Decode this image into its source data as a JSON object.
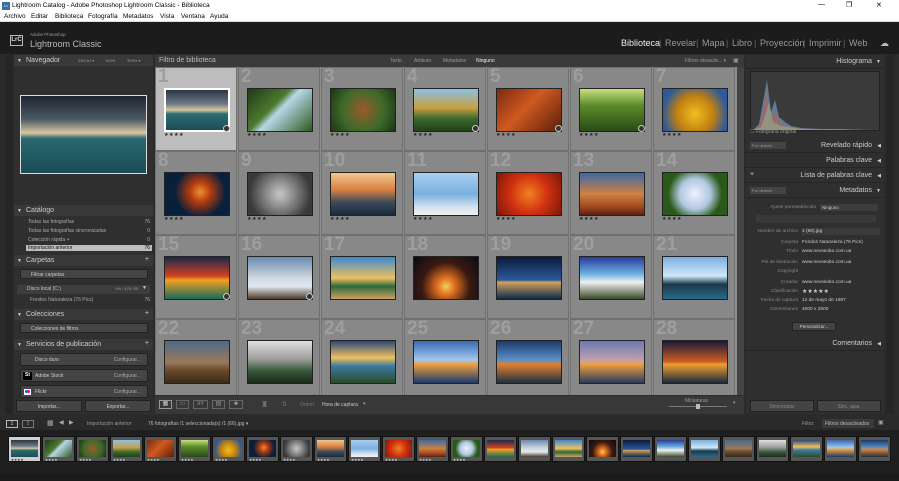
{
  "window": {
    "title": "Lightroom Catalog - Adobe Photoshop Lightroom Classic - Biblioteca",
    "icon": "Lr",
    "controls": [
      "—",
      "❐",
      "✕"
    ]
  },
  "menu": [
    "Archivo",
    "Editar",
    "Biblioteca",
    "Fotografía",
    "Metadatos",
    "Vista",
    "Ventana",
    "Ayuda"
  ],
  "brand": {
    "logo": "LrC",
    "line1": "Adobe Photoshop",
    "line2": "Lightroom Classic"
  },
  "modules": [
    "Biblioteca",
    "Revelar",
    "Mapa",
    "Libro",
    "Proyección",
    "Imprimir",
    "Web"
  ],
  "navigator": {
    "title": "Navegador",
    "zoom": [
      "ENCAJ ▾",
      "100%",
      "300% ▾"
    ]
  },
  "catalog": {
    "title": "Catálogo",
    "items": [
      {
        "label": "Todas las fotografías",
        "count": "76"
      },
      {
        "label": "Todas las fotografías sincronizadas",
        "count": "0"
      },
      {
        "label": "Colección rápida +",
        "count": "0"
      },
      {
        "label": "Importación anterior",
        "count": "76"
      }
    ]
  },
  "folders": {
    "title": "Carpetas",
    "filter": "Filtrar carpetas",
    "drive": "Disco local (C:)",
    "drive_space": "9% / 476 GB",
    "folder": "Fondos Naturaleza (76 Pics)",
    "folder_count": "76"
  },
  "collections": {
    "title": "Colecciones",
    "filter": "Colecciones de filtros"
  },
  "publish": {
    "title": "Servicios de publicación",
    "services": [
      {
        "name": "Disco duro",
        "action": "Configurar..."
      },
      {
        "name": "Adobe Stock",
        "action": "Configurar..."
      },
      {
        "name": "Flickr",
        "action": "Configurar..."
      }
    ]
  },
  "left_buttons": {
    "import": "Importar...",
    "export": "Exportar..."
  },
  "filterbar": {
    "title": "Filtro de biblioteca",
    "tabs": [
      "Texto",
      "Atributo",
      "Metadatos",
      "Ninguno"
    ],
    "preset": "Filtros desactiv... ▾"
  },
  "grid": {
    "cells": [
      {
        "num": "1",
        "stars": "★★★★",
        "selected": true
      },
      {
        "num": "2",
        "stars": "★★★★"
      },
      {
        "num": "3",
        "stars": "★★★★"
      },
      {
        "num": "4",
        "stars": "★★★★"
      },
      {
        "num": "5",
        "stars": "★★★★"
      },
      {
        "num": "6",
        "stars": "★★★★"
      },
      {
        "num": "7",
        "stars": "★★★★"
      },
      {
        "num": "8",
        "stars": "★★★★"
      },
      {
        "num": "9",
        "stars": "★★★★"
      },
      {
        "num": "10",
        "stars": "★★★★"
      },
      {
        "num": "11",
        "stars": "★★★★"
      },
      {
        "num": "12",
        "stars": "★★★★"
      },
      {
        "num": "13",
        "stars": "★★★★"
      },
      {
        "num": "14",
        "stars": "★★★★"
      },
      {
        "num": "15",
        "stars": ""
      },
      {
        "num": "16",
        "stars": ""
      },
      {
        "num": "17",
        "stars": ""
      },
      {
        "num": "18",
        "stars": ""
      },
      {
        "num": "19",
        "stars": ""
      },
      {
        "num": "20",
        "stars": ""
      },
      {
        "num": "21",
        "stars": ""
      },
      {
        "num": "22",
        "stars": ""
      },
      {
        "num": "23",
        "stars": ""
      },
      {
        "num": "24",
        "stars": ""
      },
      {
        "num": "25",
        "stars": ""
      },
      {
        "num": "26",
        "stars": ""
      },
      {
        "num": "27",
        "stars": ""
      },
      {
        "num": "28",
        "stars": ""
      }
    ]
  },
  "toolbar": {
    "sort_label": "Orden:",
    "sort_value": "Hora de captura",
    "thumb_label": "Miniaturas"
  },
  "histogram": {
    "title": "Histograma",
    "original": "Fotografía original"
  },
  "quick_develop": {
    "title": "Revelado rápido",
    "preset": "Por defecto"
  },
  "keywords": {
    "title": "Palabras clave"
  },
  "keyword_list": {
    "title": "Lista de palabras clave"
  },
  "metadata": {
    "title": "Metadatos",
    "preset_sel": "Por defecto",
    "preset_label": "Ajuste preestablecido",
    "preset_value": "Ninguno",
    "fields": [
      {
        "k": "Nombre de archivo",
        "v": "1 (66).jpg"
      },
      {
        "k": "Carpeta",
        "v": "Fondos Naturaleza (76 Pics)"
      },
      {
        "k": "Título",
        "v": "www.nevseobo.com.ua"
      },
      {
        "k": "Pie de ilustración",
        "v": "www.nevseobo.com.ua"
      },
      {
        "k": "Copyright",
        "v": ""
      },
      {
        "k": "Creador",
        "v": "www.nevseobo.com.ua"
      },
      {
        "k": "Clasificación",
        "v": "★★★★★"
      },
      {
        "k": "Fecha de captura",
        "v": "12 de mayo de 1987"
      },
      {
        "k": "Dimensiones",
        "v": "4000 x 2500"
      }
    ],
    "customize": "Personalizar..."
  },
  "comments": {
    "title": "Comentarios"
  },
  "right_buttons": {
    "sync_meta": "Sincronizar",
    "sync_settings": "Sinc. ajus."
  },
  "filmstrip": {
    "source": "Importación anterior",
    "info": "76 fotografías /1 seleccionada(s) /1 (66).jpg ▾",
    "filter_label": "Filtro:",
    "filter_value": "Filtros desactivados"
  },
  "colors": {
    "bg": "#2b2b2b",
    "grid": "#8e8e8e",
    "selected_cell": "#bdbdbd",
    "panel": "#2f2f2f"
  }
}
